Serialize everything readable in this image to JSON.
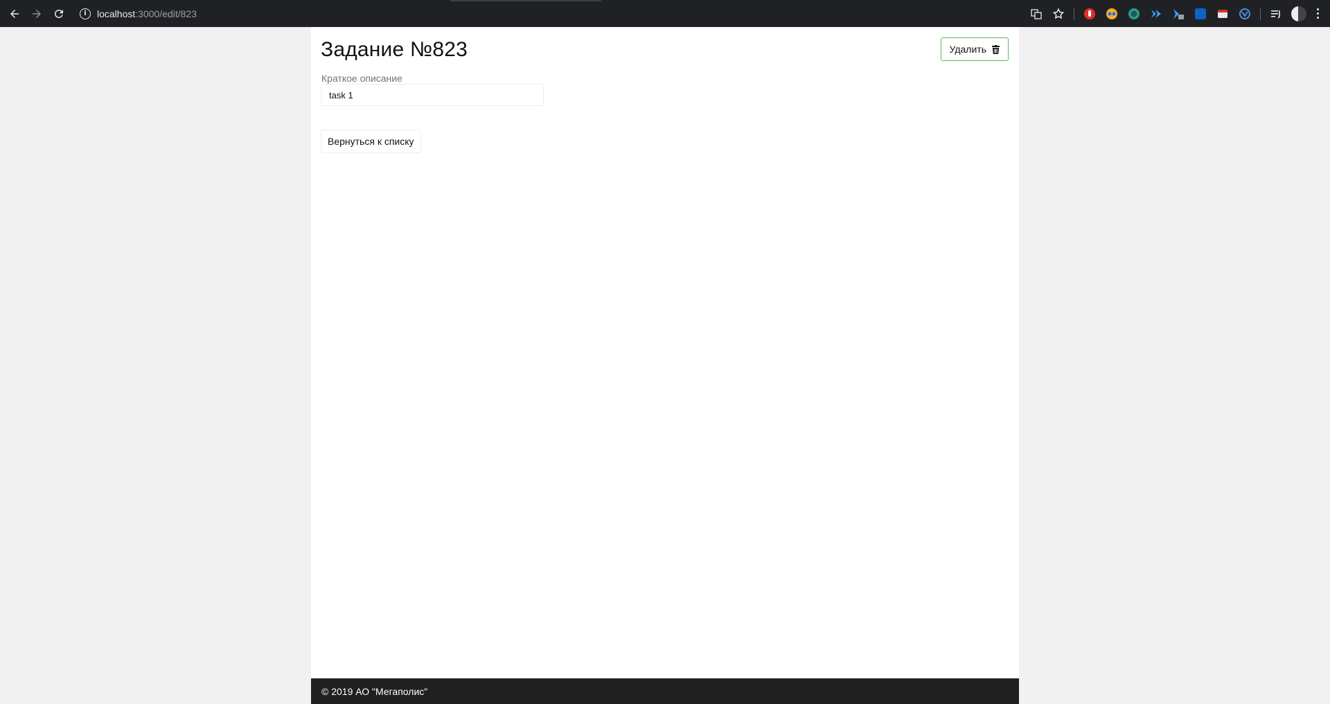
{
  "browser": {
    "url_host": "localhost",
    "url_path": ":3000/edit/823",
    "extensions": [
      "translate-icon",
      "bookmark-star-icon",
      "adblock-icon",
      "extension-icon",
      "extension-icon",
      "extension-icon",
      "extension-icon",
      "extension-icon",
      "extension-icon",
      "extension-icon",
      "reading-list-icon",
      "profile-avatar",
      "menu-icon"
    ]
  },
  "page": {
    "title": "Задание №823",
    "delete_label": "Удалить",
    "field_label": "Краткое описание",
    "field_value": "task 1",
    "back_label": "Вернуться к списку"
  },
  "footer": {
    "text": "© 2019 АО \"Мегаполис\""
  },
  "colors": {
    "chrome": "#202124",
    "page_bg": "#f1f1f1",
    "content_bg": "#ffffff",
    "delete_border": "#5cb85c",
    "footer_bg": "#202020"
  }
}
